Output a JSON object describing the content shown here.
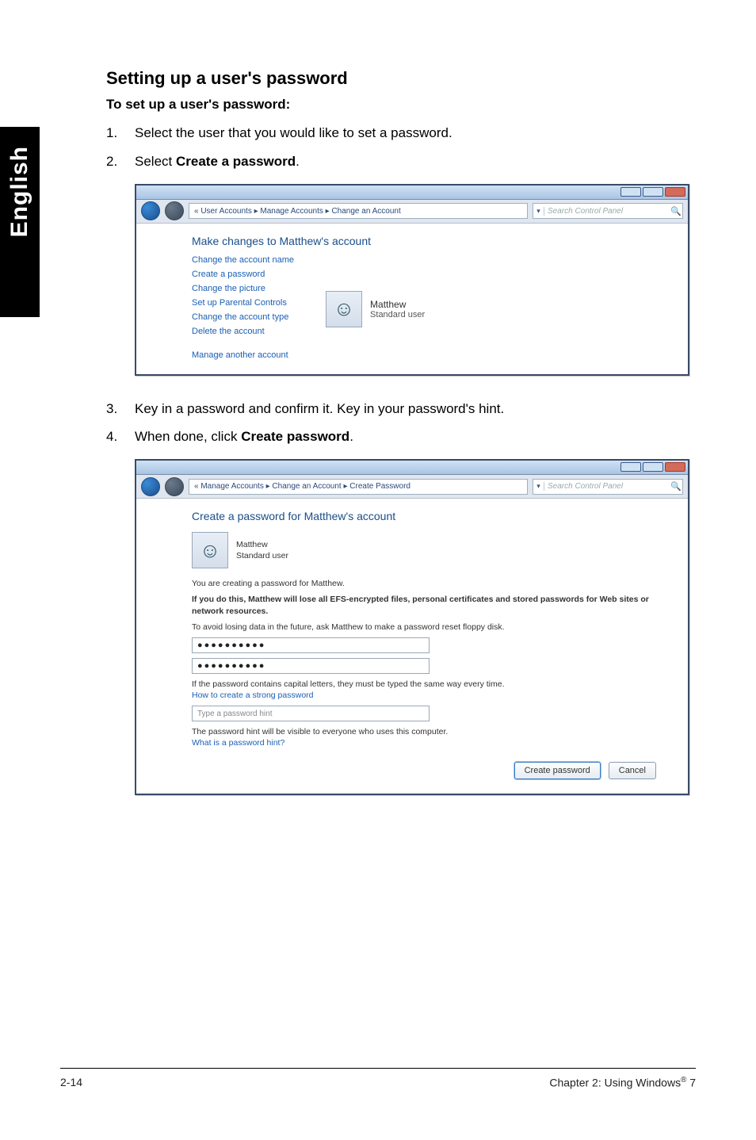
{
  "sideTab": "English",
  "title": "Setting up a user's password",
  "subtitle": "To set up a user's password:",
  "steps": {
    "s1": {
      "n": "1.",
      "t": "Select the user that you would like to set a password."
    },
    "s2": {
      "n": "2.",
      "pre": "Select ",
      "bold": "Create a password",
      "post": "."
    },
    "s3": {
      "n": "3.",
      "t": "Key in a password and confirm it. Key in your password's hint."
    },
    "s4": {
      "n": "4.",
      "pre": "When done, click ",
      "bold": "Create password",
      "post": "."
    }
  },
  "shot1": {
    "breadcrumb": "« User Accounts ▸ Manage Accounts ▸ Change an Account",
    "searchPlaceholder": "Search Control Panel",
    "heading": "Make changes to Matthew's account",
    "links": {
      "l1": "Change the account name",
      "l2": "Create a password",
      "l3": "Change the picture",
      "l4": "Set up Parental Controls",
      "l5": "Change the account type",
      "l6": "Delete the account",
      "l7": "Manage another account"
    },
    "user": {
      "name": "Matthew",
      "type": "Standard user"
    }
  },
  "shot2": {
    "breadcrumb": "« Manage Accounts ▸ Change an Account ▸ Create Password",
    "searchPlaceholder": "Search Control Panel",
    "heading": "Create a password for Matthew's account",
    "user": {
      "name": "Matthew",
      "type": "Standard user"
    },
    "line1": "You are creating a password for Matthew.",
    "line2": "If you do this, Matthew will lose all EFS-encrypted files, personal certificates and stored passwords for Web sites or network resources.",
    "line3": "To avoid losing data in the future, ask Matthew to make a password reset floppy disk.",
    "pw1": "●●●●●●●●●●",
    "pw2": "●●●●●●●●●●",
    "line4": "If the password contains capital letters, they must be typed the same way every time.",
    "link4": "How to create a strong password",
    "hintPlaceholder": "Type a password hint",
    "line5": "The password hint will be visible to everyone who uses this computer.",
    "link5": "What is a password hint?",
    "btnCreate": "Create password",
    "btnCancel": "Cancel"
  },
  "footer": {
    "left": "2-14",
    "rightPre": "Chapter 2: Using Windows",
    "rightSup": "®",
    "rightPost": " 7"
  }
}
